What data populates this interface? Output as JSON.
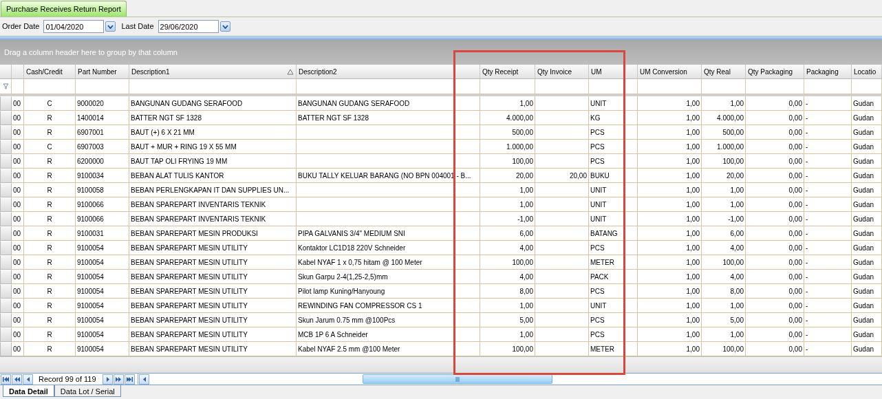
{
  "tabs": [
    {
      "label": "Purchase Receives Return Report",
      "selected": true
    }
  ],
  "filters": [
    {
      "label": "Order Date",
      "value": "01/04/2020"
    },
    {
      "label": "Last Date",
      "value": "29/06/2020"
    }
  ],
  "grid": {
    "group_panel_hint": "Drag a column header here to group by that column",
    "columns": [
      {},
      {
        "label": "Cash/Credit"
      },
      {
        "label": "Part Number"
      },
      {
        "label": "Description1",
        "sorted": true
      },
      {
        "label": "Description2"
      },
      {
        "label": "Qty Receipt"
      },
      {
        "label": "Qty Invoice"
      },
      {
        "label": "UM"
      },
      {},
      {
        "label": "UM Conversion"
      },
      {
        "label": "Qty Real"
      },
      {
        "label": "Qty Packaging"
      },
      {
        "label": "Packaging"
      },
      {
        "label": "Locatio"
      }
    ],
    "rows": [
      [
        "00",
        "C",
        "9000020",
        "BANGUNAN GUDANG SERAFOOD",
        "BANGUNAN GUDANG SERAFOOD",
        "1,00",
        null,
        "UNIT",
        null,
        "1,00",
        "1,00",
        "0,00",
        "-",
        "Gudan"
      ],
      [
        "00",
        "R",
        "1400014",
        "BATTER NGT SF 1328",
        "BATTER NGT SF 1328",
        "4.000,00",
        null,
        "KG",
        null,
        "1,00",
        "4.000,00",
        "0,00",
        "-",
        "Gudan"
      ],
      [
        "00",
        "R",
        "6907001",
        "BAUT (+) 6 X 21 MM",
        null,
        "500,00",
        null,
        "PCS",
        null,
        "1,00",
        "500,00",
        "0,00",
        "-",
        "Gudan"
      ],
      [
        "00",
        "C",
        "6907003",
        "BAUT + MUR + RING 19 X 55 MM",
        null,
        "1.000,00",
        null,
        "PCS",
        null,
        "1,00",
        "1.000,00",
        "0,00",
        "-",
        "Gudan"
      ],
      [
        "00",
        "R",
        "6200000",
        "BAUT TAP OLI FRYING 19 MM",
        null,
        "100,00",
        null,
        "PCS",
        null,
        "1,00",
        "100,00",
        "0,00",
        "-",
        "Gudan"
      ],
      [
        "00",
        "R",
        "9100034",
        "BEBAN ALAT TULIS KANTOR",
        "BUKU TALLY KELUAR BARANG (NO BPN 004001 - B...",
        "20,00",
        "20,00",
        "BUKU",
        null,
        "1,00",
        "20,00",
        "0,00",
        "-",
        "Gudan"
      ],
      [
        "00",
        "R",
        "9100058",
        "BEBAN PERLENGKAPAN IT DAN SUPPLIES UN...",
        null,
        "1,00",
        null,
        "UNIT",
        null,
        "1,00",
        "1,00",
        "0,00",
        "-",
        "Gudan"
      ],
      [
        "00",
        "R",
        "9100066",
        "BEBAN SPAREPART INVENTARIS TEKNIK",
        null,
        "1,00",
        null,
        "UNIT",
        null,
        "1,00",
        "1,00",
        "0,00",
        "-",
        "Gudan"
      ],
      [
        "00",
        "R",
        "9100066",
        "BEBAN SPAREPART INVENTARIS TEKNIK",
        null,
        "-1,00",
        null,
        "UNIT",
        null,
        "1,00",
        "-1,00",
        "0,00",
        "-",
        "Gudan"
      ],
      [
        "00",
        "R",
        "9100031",
        "BEBAN SPAREPART MESIN PRODUKSI",
        "PIPA GALVANIS 3/4\" MEDIUM SNI",
        "6,00",
        null,
        "BATANG",
        null,
        "1,00",
        "6,00",
        "0,00",
        "-",
        "Gudan"
      ],
      [
        "00",
        "R",
        "9100054",
        "BEBAN SPAREPART MESIN UTILITY",
        "Kontaktor LC1D18 220V Schneider",
        "4,00",
        null,
        "PCS",
        null,
        "1,00",
        "4,00",
        "0,00",
        "-",
        "Gudan"
      ],
      [
        "00",
        "R",
        "9100054",
        "BEBAN SPAREPART MESIN UTILITY",
        "Kabel NYAF 1 x 0,75  hitam @ 100 Meter",
        "100,00",
        null,
        "METER",
        null,
        "1,00",
        "100,00",
        "0,00",
        "-",
        "Gudan"
      ],
      [
        "00",
        "R",
        "9100054",
        "BEBAN SPAREPART MESIN UTILITY",
        "Skun Garpu 2-4(1,25-2,5)mm",
        "4,00",
        null,
        "PACK",
        null,
        "1,00",
        "4,00",
        "0,00",
        "-",
        "Gudan"
      ],
      [
        "00",
        "R",
        "9100054",
        "BEBAN SPAREPART MESIN UTILITY",
        "Pilot lamp Kuning/Hanyoung",
        "8,00",
        null,
        "PCS",
        null,
        "1,00",
        "8,00",
        "0,00",
        "-",
        "Gudan"
      ],
      [
        "00",
        "R",
        "9100054",
        "BEBAN SPAREPART MESIN UTILITY",
        "REWINDING FAN COMPRESSOR CS 1",
        "1,00",
        null,
        "UNIT",
        null,
        "1,00",
        "1,00",
        "0,00",
        "-",
        "Gudan"
      ],
      [
        "00",
        "R",
        "9100054",
        "BEBAN SPAREPART MESIN UTILITY",
        "Skun Jarum 0.75 mm @100Pcs",
        "5,00",
        null,
        "PCS",
        null,
        "1,00",
        "5,00",
        "0,00",
        "-",
        "Gudan"
      ],
      [
        "00",
        "R",
        "9100054",
        "BEBAN SPAREPART MESIN UTILITY",
        "MCB 1P 6 A Schneider",
        "1,00",
        null,
        "PCS",
        null,
        "1,00",
        "1,00",
        "0,00",
        "-",
        "Gudan"
      ],
      [
        "00",
        "R",
        "9100054",
        "BEBAN SPAREPART MESIN UTILITY",
        "Kabel NYAF 2.5 mm @100 Meter",
        "100,00",
        null,
        "METER",
        null,
        "1,00",
        "100,00",
        "0,00",
        "-",
        "Gudan"
      ]
    ]
  },
  "navigator": {
    "record_text": "Record 99 of 119"
  },
  "bottom_tabs": [
    {
      "label": "Data Detail",
      "selected": true
    },
    {
      "label": "Data Lot / Serial",
      "selected": false
    }
  ]
}
